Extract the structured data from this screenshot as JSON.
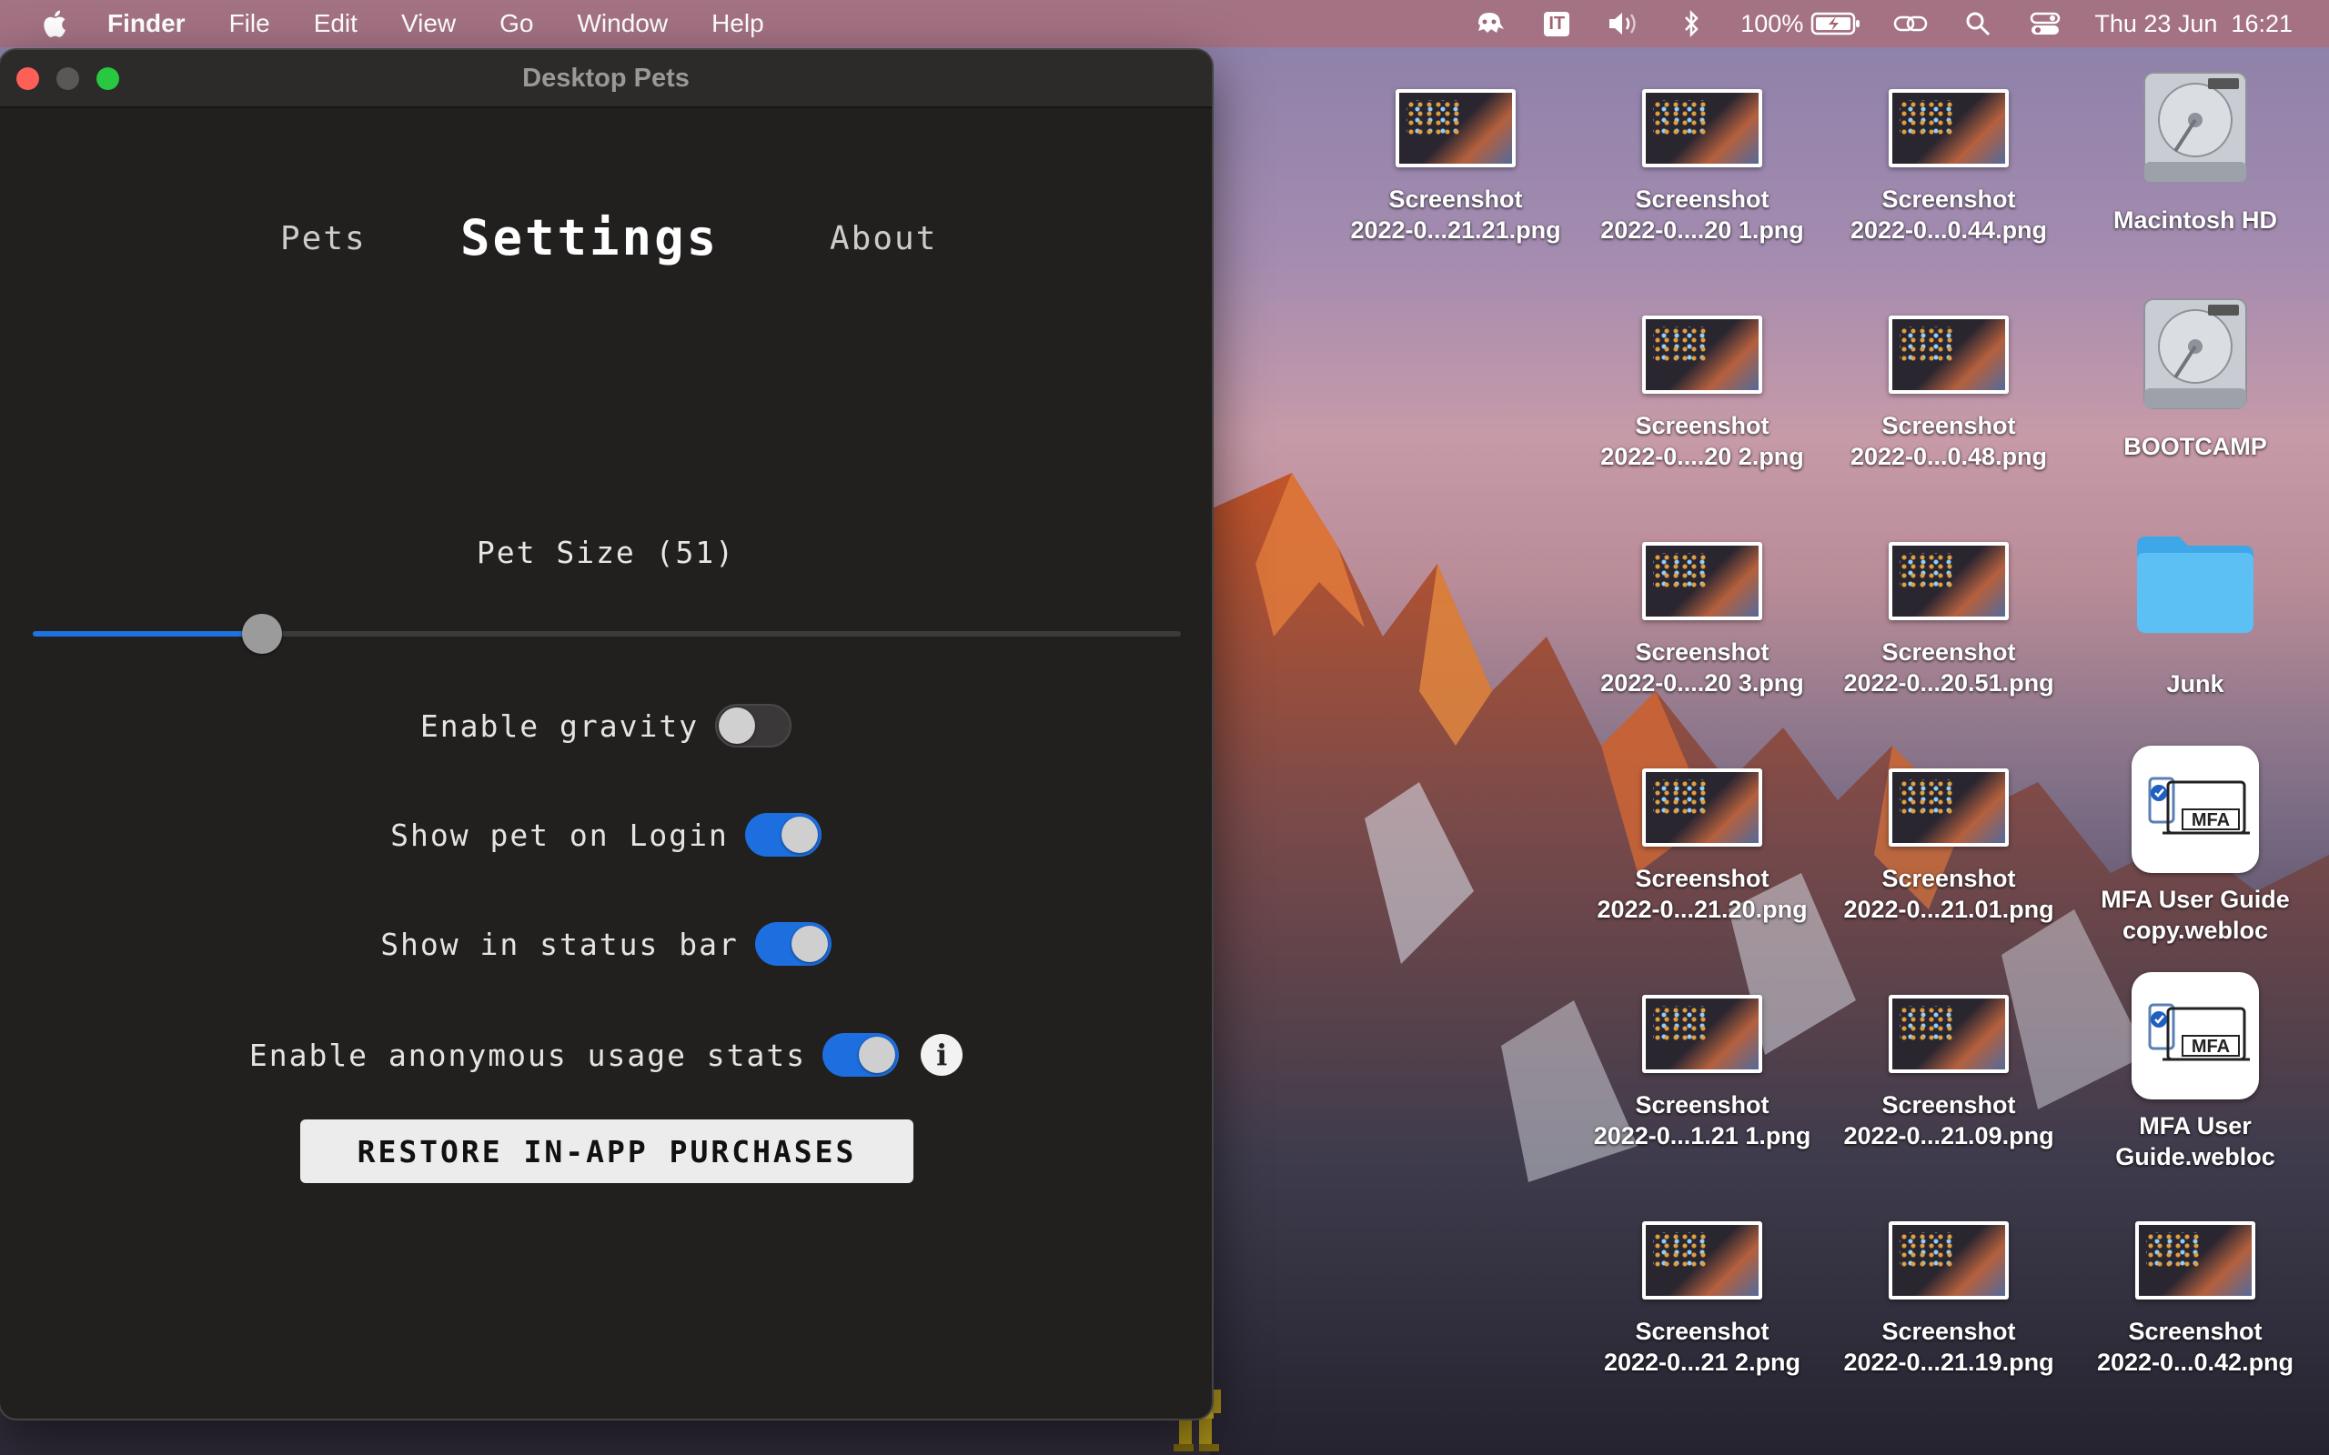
{
  "menubar": {
    "app_name": "Finder",
    "menus": [
      "File",
      "Edit",
      "View",
      "Go",
      "Window",
      "Help"
    ],
    "battery": "100%",
    "clock": "Thu 23 Jun  16:21",
    "icons": [
      "apple-icon",
      "ghost-icon",
      "input-source-icon",
      "volume-icon",
      "bluetooth-icon",
      "battery-icon",
      "screen-mirroring-icon",
      "search-icon",
      "control-center-icon"
    ],
    "input_source": "IT"
  },
  "window": {
    "title": "Desktop Pets",
    "tabs": {
      "pets": "Pets",
      "settings": "Settings",
      "about": "About",
      "active": "Settings"
    },
    "pet_size_label": "Pet Size (51)",
    "pet_size_value": 51,
    "pet_size_fraction": 0.2,
    "options": {
      "gravity": {
        "label": "Enable gravity",
        "on": false
      },
      "login": {
        "label": "Show pet on Login",
        "on": true
      },
      "status_bar": {
        "label": "Show in status bar",
        "on": true
      },
      "usage_stats": {
        "label": "Enable anonymous usage stats",
        "on": true
      }
    },
    "restore_button": "RESTORE IN-APP PURCHASES"
  },
  "desktop": {
    "icons": [
      {
        "l1": "Screenshot",
        "l2": "2022-0...21.21.png"
      },
      {
        "l1": "Screenshot",
        "l2": "2022-0....20 1.png"
      },
      {
        "l1": "Screenshot",
        "l2": "2022-0...0.44.png"
      },
      {
        "l1": "Macintosh HD",
        "l2": ""
      },
      {
        "l1": "Screenshot",
        "l2": "2022-0....20 2.png"
      },
      {
        "l1": "Screenshot",
        "l2": "2022-0...0.48.png"
      },
      {
        "l1": "BOOTCAMP",
        "l2": ""
      },
      {
        "l1": "Screenshot",
        "l2": "2022-0....20 3.png"
      },
      {
        "l1": "Screenshot",
        "l2": "2022-0...20.51.png"
      },
      {
        "l1": "Junk",
        "l2": ""
      },
      {
        "l1": "Screenshot",
        "l2": "2022-0...21.20.png"
      },
      {
        "l1": "Screenshot",
        "l2": "2022-0...21.01.png"
      },
      {
        "l1": "MFA User Guide",
        "l2": "copy.webloc"
      },
      {
        "l1": "Screenshot",
        "l2": "2022-0...1.21 1.png"
      },
      {
        "l1": "Screenshot",
        "l2": "2022-0...21.09.png"
      },
      {
        "l1": "MFA User",
        "l2": "Guide.webloc"
      },
      {
        "l1": "Screenshot",
        "l2": "2022-0...21 2.png"
      },
      {
        "l1": "Screenshot",
        "l2": "2022-0...21.19.png"
      },
      {
        "l1": "Screenshot",
        "l2": "2022-0...0.42.png"
      }
    ],
    "mfa_badge": "MFA"
  },
  "colors": {
    "accent": "#1d6fe0",
    "window_bg": "#221f1f",
    "menubar": "#aa6e78"
  }
}
